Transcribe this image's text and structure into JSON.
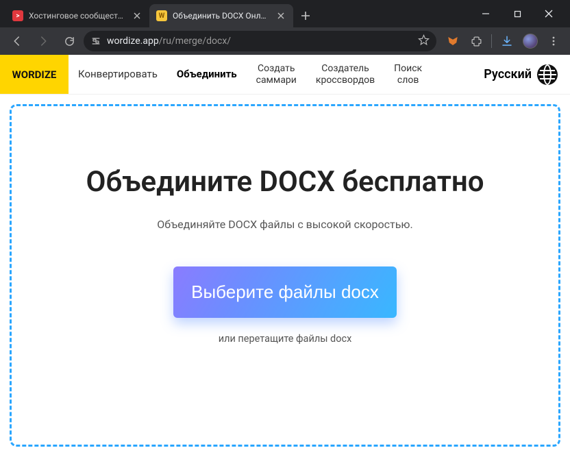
{
  "browser": {
    "tabs": [
      {
        "title": "Хостинговое сообщество «Tim",
        "active": false
      },
      {
        "title": "Объединить DOCX Онлайн",
        "active": true
      }
    ],
    "url": {
      "host": "wordize.app",
      "path": "/ru/merge/docx/"
    }
  },
  "site": {
    "logo": "WORDIZE",
    "nav": {
      "convert": "Конвертировать",
      "merge": "Объединить",
      "summary_l1": "Создать",
      "summary_l2": "саммари",
      "crossword_l1": "Создатель",
      "crossword_l2": "кроссвордов",
      "wordsearch_l1": "Поиск",
      "wordsearch_l2": "слов"
    },
    "language": "Русский"
  },
  "hero": {
    "title": "Объедините DOCX бесплатно",
    "subtitle": "Объединяйте DOCX файлы с высокой скоростью.",
    "button": "Выберите файлы docx",
    "hint": "или перетащите файлы docx"
  }
}
